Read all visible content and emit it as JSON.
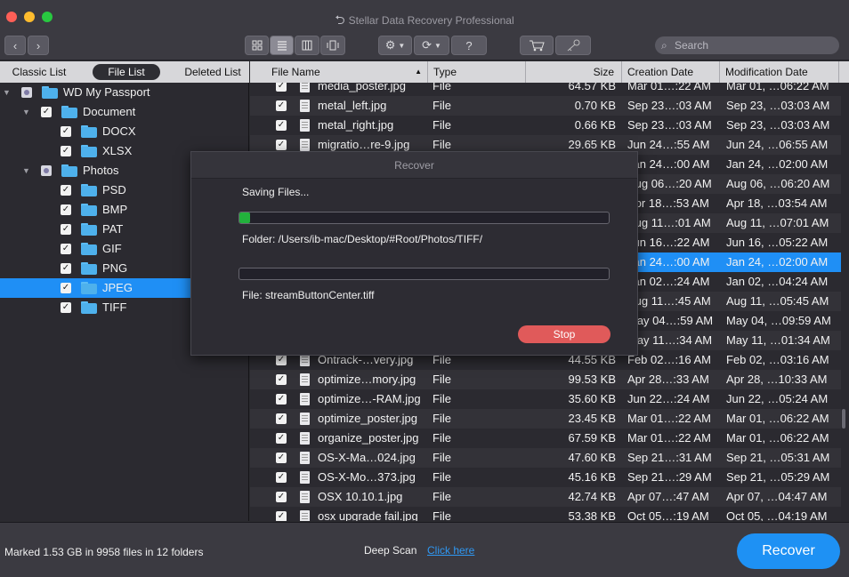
{
  "window": {
    "title": "Stellar Data Recovery Professional"
  },
  "toolbar": {
    "search_placeholder": "Search",
    "help_label": "?"
  },
  "left_tabs": [
    {
      "label": "Classic List",
      "active": false
    },
    {
      "label": "File List",
      "active": true
    },
    {
      "label": "Deleted List",
      "active": false
    }
  ],
  "tree": [
    {
      "label": "WD My Passport",
      "level": 0,
      "expanded": true,
      "check": "partial"
    },
    {
      "label": "Document",
      "level": 1,
      "expanded": true,
      "check": "checked"
    },
    {
      "label": "DOCX",
      "level": 2,
      "check": "checked"
    },
    {
      "label": "XLSX",
      "level": 2,
      "check": "checked"
    },
    {
      "label": "Photos",
      "level": 1,
      "expanded": true,
      "check": "partial"
    },
    {
      "label": "PSD",
      "level": 2,
      "check": "checked"
    },
    {
      "label": "BMP",
      "level": 2,
      "check": "checked"
    },
    {
      "label": "PAT",
      "level": 2,
      "check": "checked"
    },
    {
      "label": "GIF",
      "level": 2,
      "check": "checked"
    },
    {
      "label": "PNG",
      "level": 2,
      "check": "checked"
    },
    {
      "label": "JPEG",
      "level": 2,
      "check": "checked",
      "selected": true
    },
    {
      "label": "TIFF",
      "level": 2,
      "check": "checked"
    }
  ],
  "table": {
    "columns": {
      "name": "File Name",
      "type": "Type",
      "size": "Size",
      "created": "Creation Date",
      "modified": "Modification Date"
    },
    "rows": [
      {
        "name": "media_poster.jpg",
        "type": "File",
        "size": "64.57 KB",
        "created": "Mar 01…:22 AM",
        "modified": "Mar 01, …06:22 AM"
      },
      {
        "name": "metal_left.jpg",
        "type": "File",
        "size": "0.70 KB",
        "created": "Sep 23…:03 AM",
        "modified": "Sep 23, …03:03 AM"
      },
      {
        "name": "metal_right.jpg",
        "type": "File",
        "size": "0.66 KB",
        "created": "Sep 23…:03 AM",
        "modified": "Sep 23, …03:03 AM"
      },
      {
        "name": "migratio…re-9.jpg",
        "type": "File",
        "size": "29.65 KB",
        "created": "Jun 24…:55 AM",
        "modified": "Jun 24, …06:55 AM"
      },
      {
        "name": "",
        "type": "",
        "size": "",
        "created": "Jan 24…:00 AM",
        "modified": "Jan 24, …02:00 AM"
      },
      {
        "name": "",
        "type": "",
        "size": "",
        "created": "Aug 06…:20 AM",
        "modified": "Aug 06, …06:20 AM"
      },
      {
        "name": "",
        "type": "",
        "size": "",
        "created": "Apr 18…:53 AM",
        "modified": "Apr 18, …03:54 AM"
      },
      {
        "name": "",
        "type": "",
        "size": "",
        "created": "Aug 11…:01 AM",
        "modified": "Aug 11, …07:01 AM"
      },
      {
        "name": "",
        "type": "",
        "size": "",
        "created": "Jun 16…:22 AM",
        "modified": "Jun 16, …05:22 AM"
      },
      {
        "name": "",
        "type": "",
        "size": "",
        "created": "Jan 24…:00 AM",
        "modified": "Jan 24, …02:00 AM",
        "selected": true
      },
      {
        "name": "",
        "type": "",
        "size": "",
        "created": "Jan 02…:24 AM",
        "modified": "Jan 02, …04:24 AM"
      },
      {
        "name": "",
        "type": "",
        "size": "",
        "created": "Aug 11…:45 AM",
        "modified": "Aug 11, …05:45 AM"
      },
      {
        "name": "",
        "type": "",
        "size": "",
        "created": "May 04…:59 AM",
        "modified": "May 04, …09:59 AM"
      },
      {
        "name": "",
        "type": "",
        "size": "",
        "created": "May 11…:34 AM",
        "modified": "May 11, …01:34 AM"
      },
      {
        "name": "Ontrack-…very.jpg",
        "type": "File",
        "size": "44.55 KB",
        "created": "Feb 02…:16 AM",
        "modified": "Feb 02, …03:16 AM"
      },
      {
        "name": "optimize…mory.jpg",
        "type": "File",
        "size": "99.53 KB",
        "created": "Apr 28…:33 AM",
        "modified": "Apr 28, …10:33 AM"
      },
      {
        "name": "optimize…-RAM.jpg",
        "type": "File",
        "size": "35.60 KB",
        "created": "Jun 22…:24 AM",
        "modified": "Jun 22, …05:24 AM"
      },
      {
        "name": "optimize_poster.jpg",
        "type": "File",
        "size": "23.45 KB",
        "created": "Mar 01…:22 AM",
        "modified": "Mar 01, …06:22 AM"
      },
      {
        "name": "organize_poster.jpg",
        "type": "File",
        "size": "67.59 KB",
        "created": "Mar 01…:22 AM",
        "modified": "Mar 01, …06:22 AM"
      },
      {
        "name": "OS-X-Ma…024.jpg",
        "type": "File",
        "size": "47.60 KB",
        "created": "Sep 21…:31 AM",
        "modified": "Sep 21, …05:31 AM"
      },
      {
        "name": "OS-X-Mo…373.jpg",
        "type": "File",
        "size": "45.16 KB",
        "created": "Sep 21…:29 AM",
        "modified": "Sep 21, …05:29 AM"
      },
      {
        "name": "OSX 10.10.1.jpg",
        "type": "File",
        "size": "42.74 KB",
        "created": "Apr 07…:47 AM",
        "modified": "Apr 07, …04:47 AM"
      },
      {
        "name": "osx upgrade fail.jpg",
        "type": "File",
        "size": "53.38 KB",
        "created": "Oct 05…:19 AM",
        "modified": "Oct 05, …04:19 AM"
      }
    ]
  },
  "footer": {
    "status": "Marked 1.53 GB in 9958 files in 12 folders",
    "deep_scan_label": "Deep Scan",
    "click_here": "Click here",
    "recover_label": "Recover"
  },
  "dialog": {
    "title": "Recover",
    "saving_label": "Saving Files...",
    "folder_label": "Folder: /Users/ib-mac/Desktop/#Root/Photos/TIFF/",
    "file_label": "File: streamButtonCenter.tiff",
    "progress1": 0.03,
    "progress2": 0,
    "stop_label": "Stop"
  },
  "colors": {
    "accent": "#1f8ff5",
    "progress": "#22b13c",
    "stop": "#e05a5a"
  }
}
